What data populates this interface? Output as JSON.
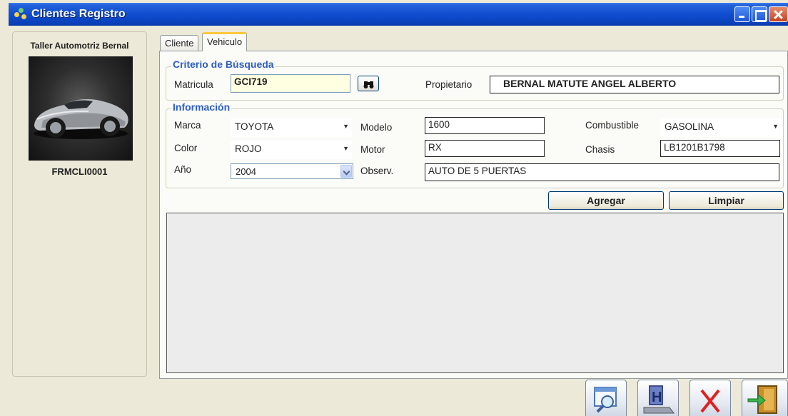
{
  "window": {
    "title": "Clientes Registro"
  },
  "left_panel": {
    "company": "Taller Automotriz Bernal",
    "form_code": "FRMCLI0001"
  },
  "tabs": [
    {
      "label": "Cliente",
      "active": false
    },
    {
      "label": "Vehiculo",
      "active": true
    }
  ],
  "busqueda": {
    "title": "Criterio de Búsqueda",
    "matricula_label": "Matricula",
    "matricula_value": "GCI719",
    "search_icon": "binoculars-icon",
    "propietario_label": "Propietario",
    "propietario_value": "BERNAL MATUTE ANGEL ALBERTO"
  },
  "informacion": {
    "title": "Información",
    "marca_label": "Marca",
    "marca_value": "TOYOTA",
    "color_label": "Color",
    "color_value": "ROJO",
    "anio_label": "Año",
    "anio_value": "2004",
    "modelo_label": "Modelo",
    "modelo_value": "1600",
    "motor_label": "Motor",
    "motor_value": "RX",
    "observ_label": "Observ.",
    "observ_value": "AUTO DE 5 PUERTAS",
    "combustible_label": "Combustible",
    "combustible_value": "GASOLINA",
    "chasis_label": "Chasis",
    "chasis_value": "LB1201B1798"
  },
  "actions": {
    "agregar": "Agregar",
    "limpiar": "Limpiar"
  },
  "toolbar": {
    "icons": [
      "search-document-icon",
      "save-icon",
      "delete-icon",
      "exit-icon"
    ]
  },
  "colors": {
    "titlebar": "#0f4ed0",
    "group_title": "#2c5fc0",
    "highlight_field": "#ffffe1",
    "delete_red": "#e02020"
  }
}
